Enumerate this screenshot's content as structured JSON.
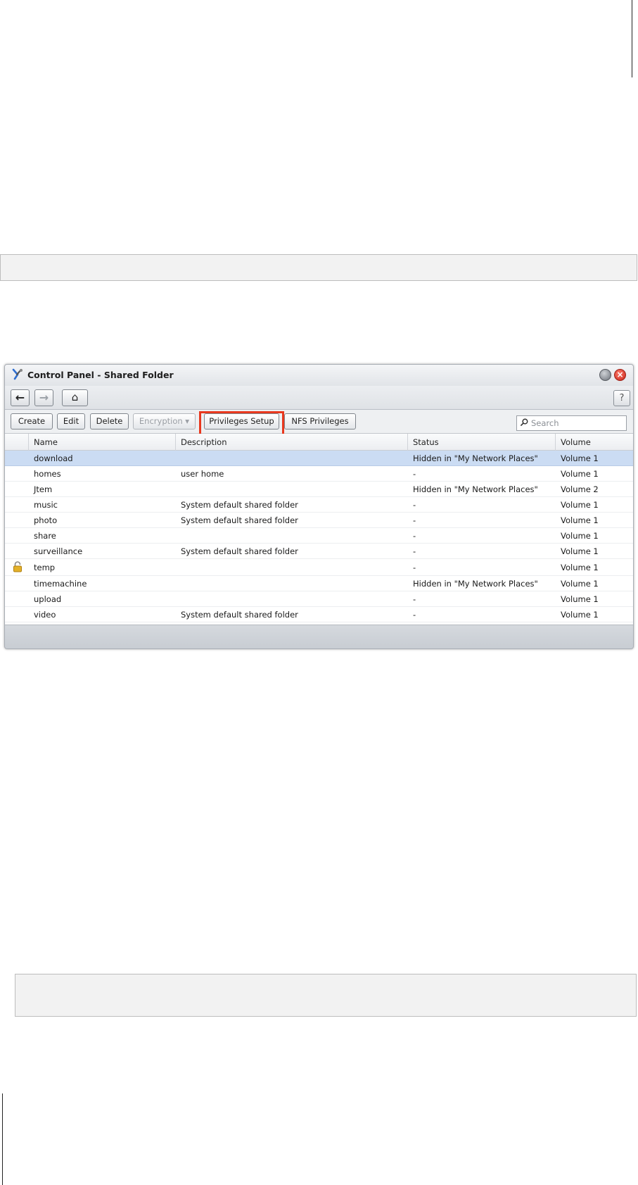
{
  "window": {
    "title": "Control Panel - Shared Folder",
    "help_label": "?",
    "close_glyph": "×"
  },
  "nav": {
    "back": "←",
    "forward": "→",
    "home": "⌂"
  },
  "toolbar": {
    "create": "Create",
    "edit": "Edit",
    "delete": "Delete",
    "encryption": "Encryption ▾",
    "privileges_setup": "Privileges Setup",
    "nfs_privileges": "NFS Privileges",
    "search_placeholder": "Search"
  },
  "columns": [
    "Name",
    "Description",
    "Status",
    "Volume"
  ],
  "rows": [
    {
      "name": "download",
      "description": "",
      "status": "Hidden in \"My Network Places\"",
      "volume": "Volume 1",
      "selected": true
    },
    {
      "name": "homes",
      "description": "user home",
      "status": "-",
      "volume": "Volume 1"
    },
    {
      "name": "Jtem",
      "description": "",
      "status": "Hidden in \"My Network Places\"",
      "volume": "Volume 2"
    },
    {
      "name": "music",
      "description": "System default shared folder",
      "status": "-",
      "volume": "Volume 1"
    },
    {
      "name": "photo",
      "description": "System default shared folder",
      "status": "-",
      "volume": "Volume 1"
    },
    {
      "name": "share",
      "description": "",
      "status": "-",
      "volume": "Volume 1"
    },
    {
      "name": "surveillance",
      "description": "System default shared folder",
      "status": "-",
      "volume": "Volume 1"
    },
    {
      "name": "temp",
      "description": "",
      "status": "-",
      "volume": "Volume 1",
      "locked": true
    },
    {
      "name": "timemachine",
      "description": "",
      "status": "Hidden in \"My Network Places\"",
      "volume": "Volume 1"
    },
    {
      "name": "upload",
      "description": "",
      "status": "-",
      "volume": "Volume 1"
    },
    {
      "name": "video",
      "description": "System default shared folder",
      "status": "-",
      "volume": "Volume 1"
    }
  ],
  "colors": {
    "highlight": "#e8381e",
    "selected_row": "#cbdcf3"
  }
}
